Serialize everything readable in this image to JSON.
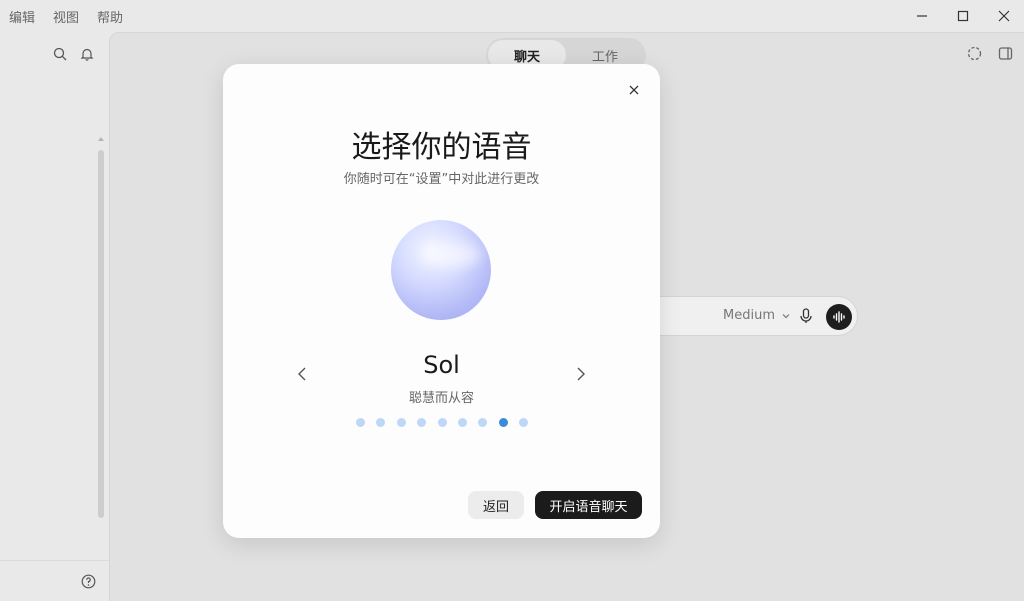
{
  "menu": {
    "items": [
      "编辑",
      "视图",
      "帮助"
    ]
  },
  "window_controls": {
    "icons": [
      "minimize-icon",
      "maximize-icon",
      "close-icon"
    ]
  },
  "sidebar": {
    "icons": [
      "search-icon",
      "bell-icon",
      "help-icon"
    ]
  },
  "tabs": [
    {
      "label": "聊天",
      "active": true
    },
    {
      "label": "工作",
      "active": false
    }
  ],
  "composer": {
    "model": "Medium"
  },
  "modal": {
    "title": "选择你的语音",
    "subtitle": "你随时可在“设置”中对此进行更改",
    "voice_name": "Sol",
    "voice_description": "聪慧而从容",
    "dot_count": 9,
    "active_dot_index": 7,
    "back_label": "返回",
    "start_label": "开启语音聊天"
  },
  "colors": {
    "accent_dot": "#3b8bd8",
    "inactive_dot": "#bcd8f6",
    "primary_button": "#1b1b1b"
  }
}
